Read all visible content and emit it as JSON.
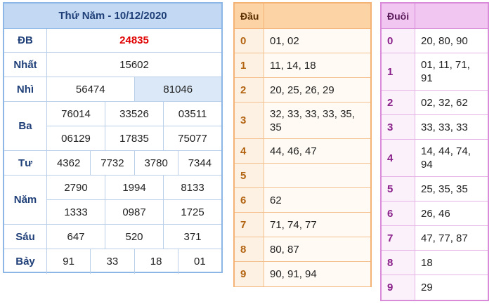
{
  "results": {
    "title": "Thứ Năm - 10/12/2020",
    "rows": [
      {
        "label": "ĐB",
        "lines": [
          [
            "24835"
          ]
        ]
      },
      {
        "label": "Nhất",
        "lines": [
          [
            "15602"
          ]
        ]
      },
      {
        "label": "Nhì",
        "lines": [
          [
            "56474",
            "81046"
          ]
        ]
      },
      {
        "label": "Ba",
        "lines": [
          [
            "76014",
            "33526",
            "03511"
          ],
          [
            "06129",
            "17835",
            "75077"
          ]
        ]
      },
      {
        "label": "Tư",
        "lines": [
          [
            "4362",
            "7732",
            "3780",
            "7344"
          ]
        ]
      },
      {
        "label": "Năm",
        "lines": [
          [
            "2790",
            "1994",
            "8133"
          ],
          [
            "1333",
            "0987",
            "1725"
          ]
        ]
      },
      {
        "label": "Sáu",
        "lines": [
          [
            "647",
            "520",
            "371"
          ]
        ]
      },
      {
        "label": "Bảy",
        "lines": [
          [
            "91",
            "33",
            "18",
            "01"
          ]
        ]
      }
    ]
  },
  "dau": {
    "header": "Đầu",
    "rows": [
      {
        "k": "0",
        "v": "01, 02"
      },
      {
        "k": "1",
        "v": "11, 14, 18"
      },
      {
        "k": "2",
        "v": "20, 25, 26, 29"
      },
      {
        "k": "3",
        "v": "32, 33, 33, 33, 35, 35"
      },
      {
        "k": "4",
        "v": "44, 46, 47"
      },
      {
        "k": "5",
        "v": ""
      },
      {
        "k": "6",
        "v": "62"
      },
      {
        "k": "7",
        "v": "71, 74, 77"
      },
      {
        "k": "8",
        "v": "80, 87"
      },
      {
        "k": "9",
        "v": "90, 91, 94"
      }
    ]
  },
  "duoi": {
    "header": "Đuôi",
    "rows": [
      {
        "k": "0",
        "v": "20, 80, 90"
      },
      {
        "k": "1",
        "v": "01, 11, 71, 91"
      },
      {
        "k": "2",
        "v": "02, 32, 62"
      },
      {
        "k": "3",
        "v": "33, 33, 33"
      },
      {
        "k": "4",
        "v": "14, 44, 74, 94"
      },
      {
        "k": "5",
        "v": "25, 35, 35"
      },
      {
        "k": "6",
        "v": "26, 46"
      },
      {
        "k": "7",
        "v": "47, 77, 87"
      },
      {
        "k": "8",
        "v": "18"
      },
      {
        "k": "9",
        "v": "29"
      }
    ]
  },
  "colors": {
    "special_prize": "#e00000",
    "results_accent": "#8cb6e6",
    "dau_accent": "#f4b374",
    "duoi_accent": "#d98bd9"
  }
}
